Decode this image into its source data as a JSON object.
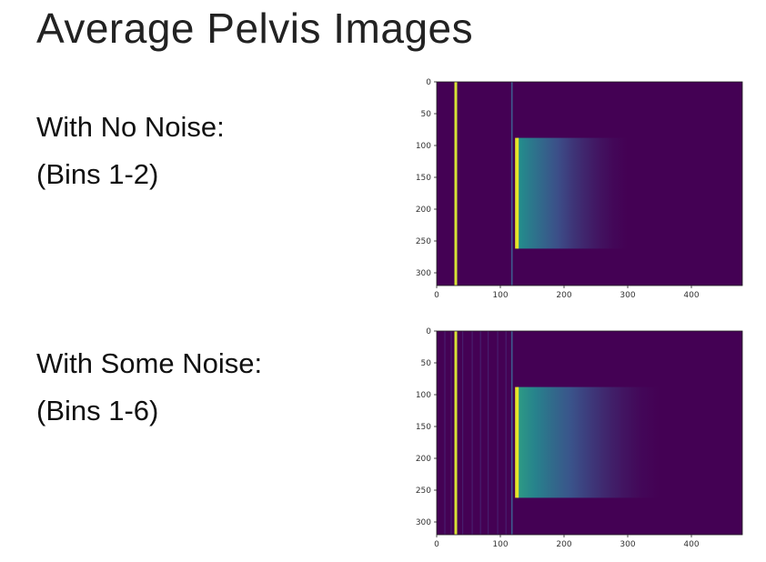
{
  "slide": {
    "title": "Average Pelvis Images"
  },
  "panels": [
    {
      "caption_line1": "With No Noise:",
      "caption_line2": "(Bins 1-2)"
    },
    {
      "caption_line1": "With Some Noise:",
      "caption_line2": "(Bins 1-6)"
    }
  ],
  "chart_data": [
    {
      "type": "heatmap",
      "title": "",
      "xlabel": "",
      "ylabel": "",
      "xlim": [
        0,
        480
      ],
      "ylim": [
        320,
        0
      ],
      "xticks": [
        0,
        100,
        200,
        300,
        400
      ],
      "yticks": [
        0,
        50,
        100,
        150,
        200,
        250,
        300
      ],
      "colormap": "viridis",
      "background_color": "#440154",
      "features": {
        "bright_line_x": 30,
        "faint_line_x": 117,
        "edge_x": 126,
        "band_y": [
          88,
          262
        ],
        "fade_end_x": 300
      },
      "noise": false
    },
    {
      "type": "heatmap",
      "title": "",
      "xlabel": "",
      "ylabel": "",
      "xlim": [
        0,
        480
      ],
      "ylim": [
        320,
        0
      ],
      "xticks": [
        0,
        100,
        200,
        300,
        400
      ],
      "yticks": [
        0,
        50,
        100,
        150,
        200,
        250,
        300
      ],
      "colormap": "viridis",
      "background_color": "#440154",
      "features": {
        "bright_line_x": 30,
        "faint_line_x": 117,
        "edge_x": 126,
        "band_y": [
          88,
          262
        ],
        "fade_end_x": 350
      },
      "noise": true
    }
  ]
}
